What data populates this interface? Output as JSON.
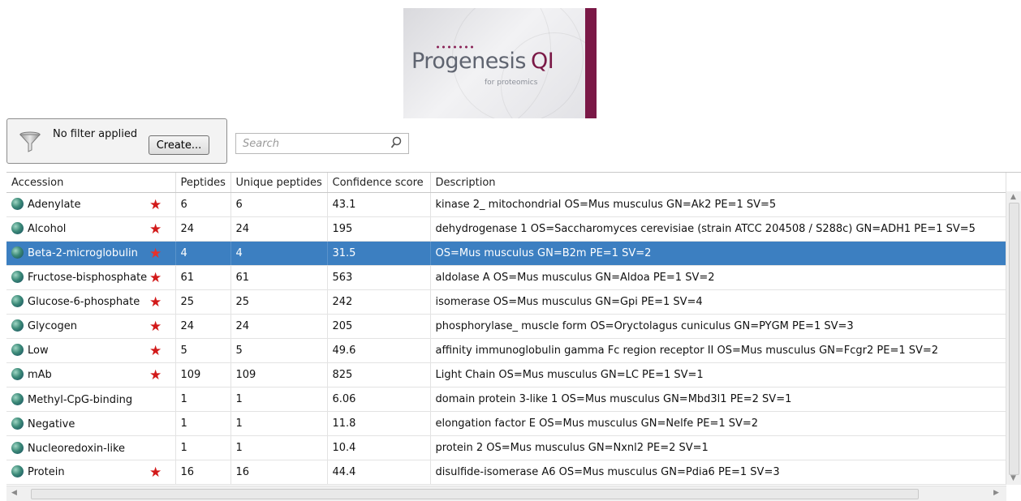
{
  "logo": {
    "brand": "Progenesis",
    "mark": "QI",
    "tagline": "for proteomics"
  },
  "filter": {
    "status_text": "No filter applied",
    "create_label": "Create..."
  },
  "search": {
    "placeholder": "Search"
  },
  "table": {
    "columns": [
      "Accession",
      "Peptides",
      "Unique peptides",
      "Confidence score",
      "Description"
    ],
    "rows": [
      {
        "accession": "Adenylate",
        "starred": true,
        "peptides": "6",
        "unique": "6",
        "score": "43.1",
        "description": "kinase 2_ mitochondrial OS=Mus musculus GN=Ak2 PE=1 SV=5"
      },
      {
        "accession": "Alcohol",
        "starred": true,
        "peptides": "24",
        "unique": "24",
        "score": "195",
        "description": "dehydrogenase 1 OS=Saccharomyces cerevisiae (strain ATCC 204508 / S288c) GN=ADH1 PE=1 SV=5"
      },
      {
        "accession": "Beta-2-microglobulin",
        "starred": true,
        "selected": true,
        "peptides": "4",
        "unique": "4",
        "score": "31.5",
        "description": "OS=Mus musculus GN=B2m PE=1 SV=2"
      },
      {
        "accession": "Fructose-bisphosphate",
        "starred": true,
        "peptides": "61",
        "unique": "61",
        "score": "563",
        "description": "aldolase A OS=Mus musculus GN=Aldoa PE=1 SV=2"
      },
      {
        "accession": "Glucose-6-phosphate",
        "starred": true,
        "peptides": "25",
        "unique": "25",
        "score": "242",
        "description": "isomerase OS=Mus musculus GN=Gpi PE=1 SV=4"
      },
      {
        "accession": "Glycogen",
        "starred": true,
        "peptides": "24",
        "unique": "24",
        "score": "205",
        "description": "phosphorylase_ muscle form OS=Oryctolagus cuniculus GN=PYGM PE=1 SV=3"
      },
      {
        "accession": "Low",
        "starred": true,
        "peptides": "5",
        "unique": "5",
        "score": "49.6",
        "description": "affinity immunoglobulin gamma Fc region receptor II OS=Mus musculus GN=Fcgr2 PE=1 SV=2"
      },
      {
        "accession": "mAb",
        "starred": true,
        "peptides": "109",
        "unique": "109",
        "score": "825",
        "description": "Light Chain OS=Mus musculus GN=LC PE=1 SV=1"
      },
      {
        "accession": "Methyl-CpG-binding",
        "starred": false,
        "peptides": "1",
        "unique": "1",
        "score": "6.06",
        "description": "domain protein 3-like 1 OS=Mus musculus GN=Mbd3l1 PE=2 SV=1"
      },
      {
        "accession": "Negative",
        "starred": false,
        "peptides": "1",
        "unique": "1",
        "score": "11.8",
        "description": "elongation factor E OS=Mus musculus GN=Nelfe PE=1 SV=2"
      },
      {
        "accession": "Nucleoredoxin-like",
        "starred": false,
        "peptides": "1",
        "unique": "1",
        "score": "10.4",
        "description": "protein 2 OS=Mus musculus GN=Nxnl2 PE=2 SV=1"
      },
      {
        "accession": "Protein",
        "starred": true,
        "peptides": "16",
        "unique": "16",
        "score": "44.4",
        "description": "disulfide-isomerase A6 OS=Mus musculus GN=Pdia6 PE=1 SV=3"
      }
    ]
  },
  "icons": {
    "filter": "funnel-icon",
    "search": "magnifier-icon",
    "row": "globe-icon",
    "flag": "star-icon"
  },
  "colors": {
    "selection": "#3c7fc1",
    "star": "#d21a1a",
    "brand": "#7a1846"
  }
}
